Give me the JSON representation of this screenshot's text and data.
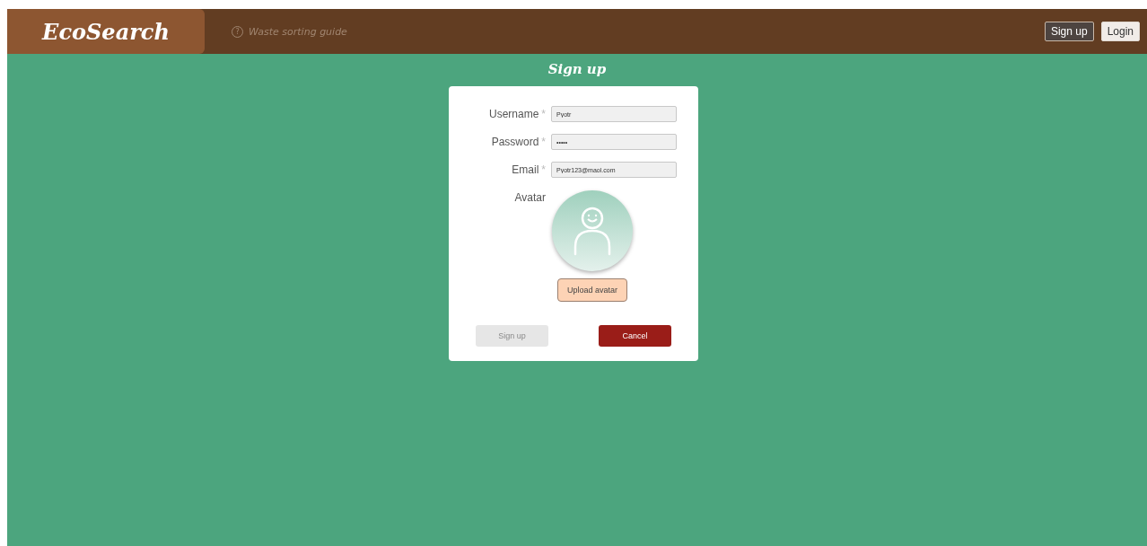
{
  "header": {
    "logo": "EcoSearch",
    "guide_link": {
      "icon": "?",
      "label": "Waste sorting guide"
    },
    "buttons": [
      {
        "label": "Sign up",
        "kind": "outline"
      },
      {
        "label": "Login",
        "kind": "light"
      }
    ]
  },
  "form": {
    "title": "Sign up",
    "fields": [
      {
        "label": "Username",
        "required_mark": "*",
        "value": "Pyotr"
      },
      {
        "label": "Password",
        "required_mark": "*",
        "value": "•••••"
      },
      {
        "label": "Email",
        "required_mark": "*",
        "value": "Pyotr123@maol.com"
      }
    ],
    "avatar": {
      "label": "Avatar",
      "upload_button": "Upload avatar"
    },
    "submit": {
      "label": "Sign up",
      "disabled": true
    },
    "cancel": {
      "label": "Cancel"
    }
  }
}
